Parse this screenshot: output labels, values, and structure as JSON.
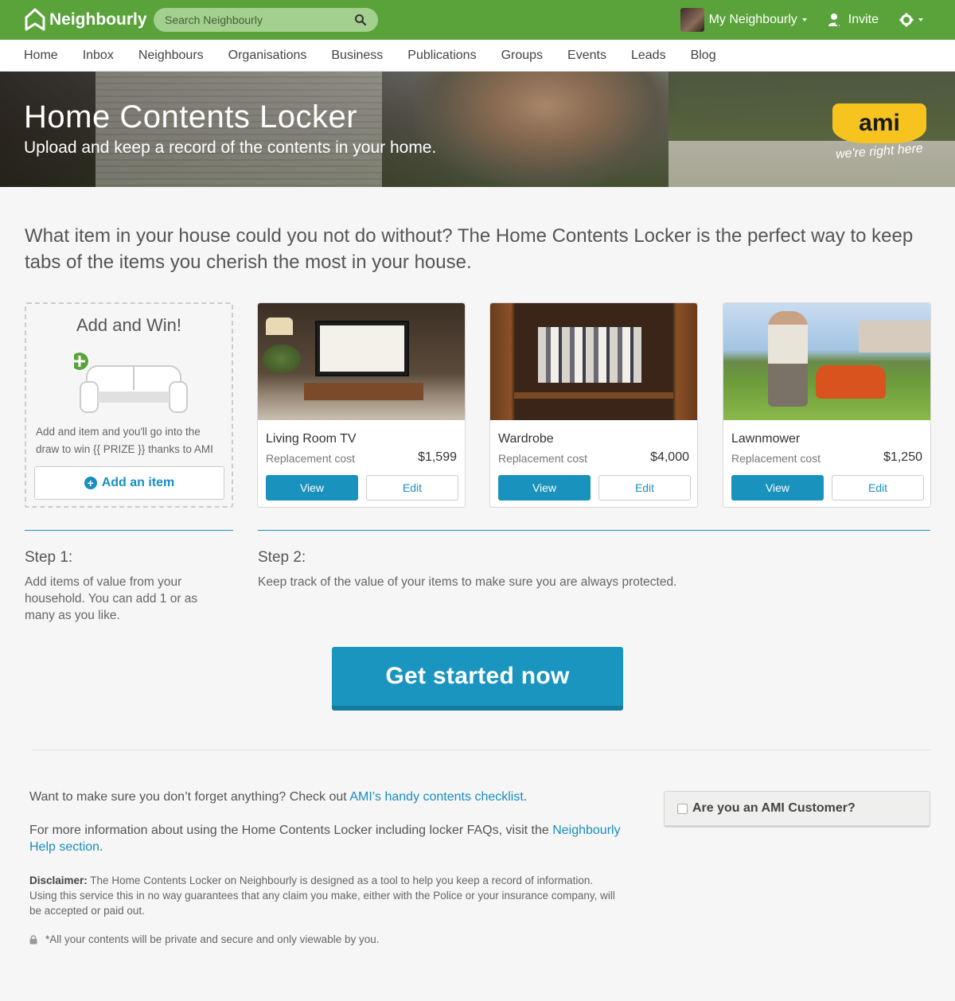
{
  "header": {
    "logo_text": "Neighbourly",
    "search_placeholder": "Search Neighbourly",
    "account_label": "My Neighbourly",
    "invite_label": "Invite"
  },
  "nav": [
    "Home",
    "Inbox",
    "Neighbours",
    "Organisations",
    "Business",
    "Publications",
    "Groups",
    "Events",
    "Leads",
    "Blog"
  ],
  "hero": {
    "title": "Home Contents Locker",
    "subtitle": "Upload and keep a record of the contents in your home.",
    "badge_logo": "ami",
    "badge_tagline": "we're right here"
  },
  "intro": "What item in your house could you not do without? The Home Contents Locker is the perfect way to keep tabs of the items you cherish the most in your house.",
  "add_card": {
    "title": "Add and Win!",
    "description": "Add and item and you'll go into the draw to win {{ PRIZE }} thanks to AMI",
    "button_label": "Add an item"
  },
  "items": [
    {
      "name": "Living Room TV",
      "cost_label": "Replacement cost",
      "price": "$1,599",
      "view_label": "View",
      "edit_label": "Edit"
    },
    {
      "name": "Wardrobe",
      "cost_label": "Replacement cost",
      "price": "$4,000",
      "view_label": "View",
      "edit_label": "Edit"
    },
    {
      "name": "Lawnmower",
      "cost_label": "Replacement cost",
      "price": "$1,250",
      "view_label": "View",
      "edit_label": "Edit"
    }
  ],
  "steps": [
    {
      "heading": "Step 1:",
      "text": "Add items of value from your household. You can add 1 or as many as you like."
    },
    {
      "heading": "Step 2:",
      "text": "Keep track of the value of your items to make sure you are always protected."
    }
  ],
  "cta_label": "Get started now",
  "footer": {
    "checklist_text": "Want to make sure you don’t forget anything? Check out ",
    "checklist_link": "AMI’s handy contents checklist",
    "checklist_end": ".",
    "help_text": "For more information about using the Home Contents Locker including locker FAQs, visit the ",
    "help_link": "Neighbourly Help section",
    "help_end": ".",
    "disclaimer_label": "Disclaimer:",
    "disclaimer_text": " The Home Contents Locker on Neighbourly is designed as a tool to help you keep a record of information. Using this service this in no way guarantees that any claim you make, either with the Police or your insurance company, will be accepted or paid out.",
    "secure_text": "*All your contents will be private and secure and only viewable by you."
  },
  "ami_customer_label": "Are you an AMI Customer?",
  "colors": {
    "brand_green": "#5aa33a",
    "accent_blue": "#1a95c0",
    "badge_yellow": "#f7c31e"
  }
}
